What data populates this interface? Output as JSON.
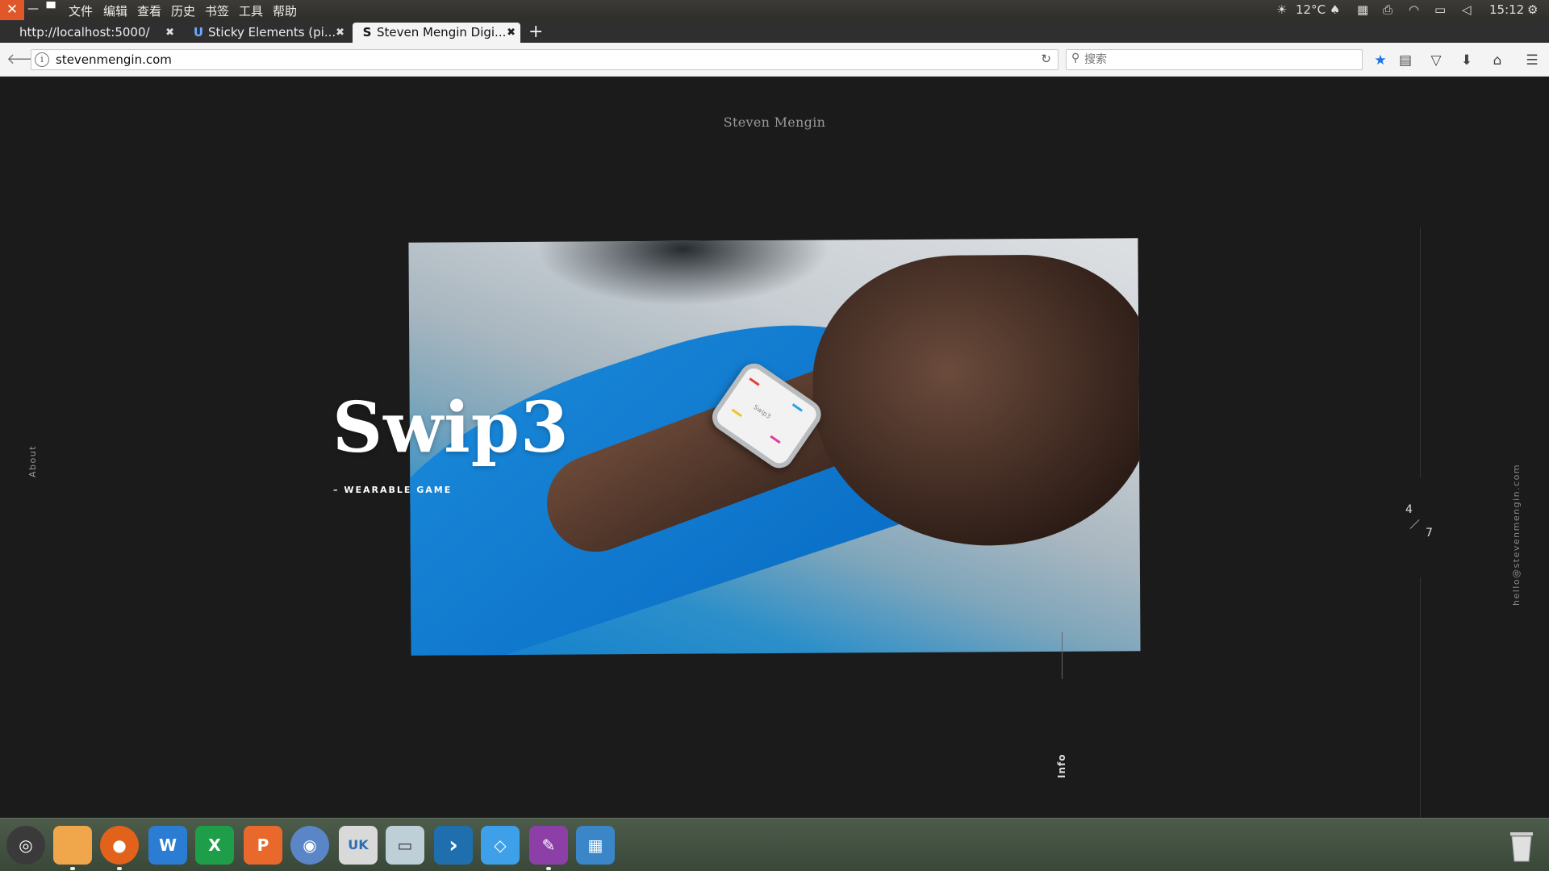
{
  "panel": {
    "menu": [
      "文件",
      "编辑",
      "查看",
      "历史",
      "书签",
      "工具",
      "帮助"
    ],
    "weather": "12°C",
    "time": "15:12"
  },
  "tabs": [
    {
      "label": "http://localhost:5000/",
      "favicon": ""
    },
    {
      "label": "Sticky Elements (pi...",
      "favicon": "U"
    },
    {
      "label": "Steven Mengin Digi...",
      "favicon": "S"
    }
  ],
  "navbar": {
    "url": "stevenmengin.com",
    "search_placeholder": "搜索"
  },
  "site": {
    "title": "Steven Mengin",
    "about_label": "About",
    "email": "hello@stevenmengin.com",
    "project_title": "Swip3",
    "project_subtitle": "– WEARABLE GAME",
    "info_label": "Info",
    "counter_current": "4",
    "counter_total": "7",
    "watch_text": "Swip3"
  },
  "dock": {
    "apps": [
      {
        "name": "ubuntu",
        "glyph": "◎",
        "color": "#3a3a3a"
      },
      {
        "name": "files",
        "glyph": "",
        "color": "#f0a64a"
      },
      {
        "name": "firefox",
        "glyph": "●",
        "color": "#e2621c"
      },
      {
        "name": "word",
        "glyph": "W",
        "color": "#2b7cd3"
      },
      {
        "name": "excel",
        "glyph": "X",
        "color": "#1f9e4a"
      },
      {
        "name": "powerpoint",
        "glyph": "P",
        "color": "#e9692c"
      },
      {
        "name": "chromium",
        "glyph": "◉",
        "color": "#5a86c7"
      },
      {
        "name": "software-center",
        "glyph": "UK",
        "color": "#d9d9d9"
      },
      {
        "name": "scanner",
        "glyph": "▭",
        "color": "#bfcfd8"
      },
      {
        "name": "vscode",
        "glyph": "›",
        "color": "#1f6fae"
      },
      {
        "name": "sourcetree",
        "glyph": "◇",
        "color": "#3ea0e8"
      },
      {
        "name": "editor",
        "glyph": "✎",
        "color": "#8d3fa8"
      },
      {
        "name": "workspace",
        "glyph": "▦",
        "color": "#3b86c9"
      }
    ]
  },
  "colors": {
    "page_bg": "#1b1b1c",
    "accent_star": "#1a73e8"
  }
}
